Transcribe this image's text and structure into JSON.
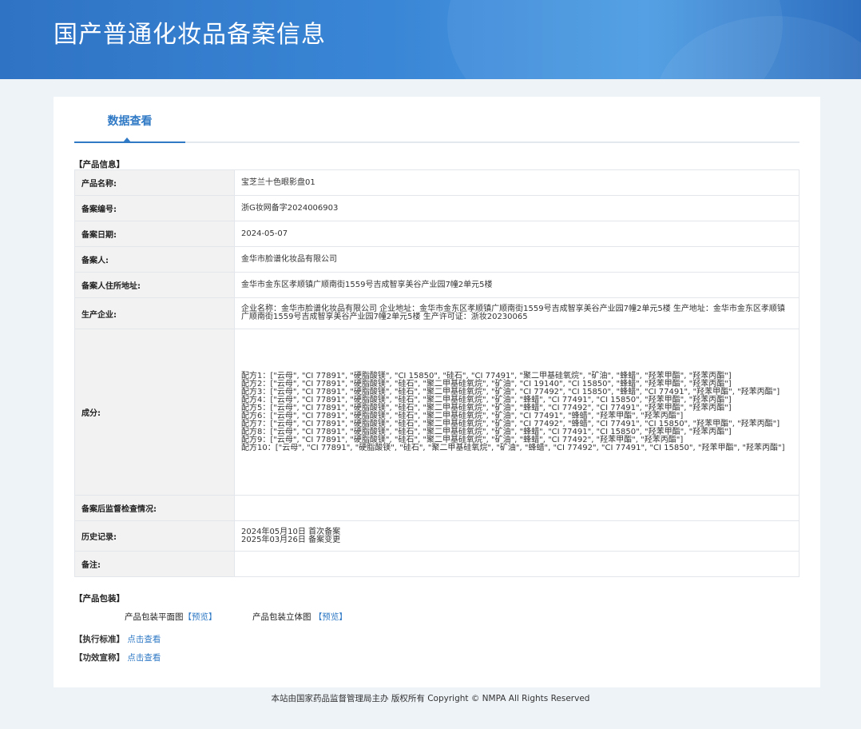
{
  "page": {
    "title": "国产普通化妆品备案信息"
  },
  "tab": {
    "label": "数据查看"
  },
  "sections": {
    "product_info": "【产品信息】",
    "packaging": "【产品包装】",
    "standard": "【执行标准】",
    "efficacy": "【功效宣称】"
  },
  "rows": [
    {
      "label": "产品名称:",
      "value": "宝芝兰十色眼影盘01"
    },
    {
      "label": "备案编号:",
      "value": "浙G妆网备字2024006903"
    },
    {
      "label": "备案日期:",
      "value": "2024-05-07"
    },
    {
      "label": "备案人:",
      "value": "金华市脸谱化妆品有限公司"
    },
    {
      "label": "备案人住所地址:",
      "value": "金华市金东区孝顺镇广顺南街1559号吉成智享美谷产业园7幢2单元5楼"
    },
    {
      "label": "生产企业:",
      "value": "企业名称：金华市脸谱化妆品有限公司 企业地址：金华市金东区孝顺镇广顺南街1559号吉成智享美谷产业园7幢2单元5楼 生产地址：金华市金东区孝顺镇广顺南街1559号吉成智享美谷产业园7幢2单元5楼 生产许可证：浙妆20230065"
    },
    {
      "label": "成分:",
      "value": [
        "配方1：[\"云母\", \"CI 77891\", \"硬脂酸镁\", \"CI 15850\", \"硅石\", \"CI 77491\", \"聚二甲基硅氧烷\", \"矿油\", \"蜂蜡\", \"羟苯甲酯\", \"羟苯丙酯\"]",
        "配方2：[\"云母\", \"CI 77891\", \"硬脂酸镁\", \"硅石\", \"聚二甲基硅氧烷\", \"矿油\", \"CI 19140\", \"CI 15850\", \"蜂蜡\", \"羟苯甲酯\", \"羟苯丙酯\"]",
        "配方3：[\"云母\", \"CI 77891\", \"硬脂酸镁\", \"硅石\", \"聚二甲基硅氧烷\", \"矿油\", \"CI 77492\", \"CI 15850\", \"蜂蜡\", \"CI 77491\", \"羟苯甲酯\", \"羟苯丙酯\"]",
        "配方4：[\"云母\", \"CI 77891\", \"硬脂酸镁\", \"硅石\", \"聚二甲基硅氧烷\", \"矿油\", \"蜂蜡\", \"CI 77491\", \"CI 15850\", \"羟苯甲酯\", \"羟苯丙酯\"]",
        "配方5：[\"云母\", \"CI 77891\", \"硬脂酸镁\", \"硅石\", \"聚二甲基硅氧烷\", \"矿油\", \"蜂蜡\", \"CI 77492\", \"CI 77491\", \"羟苯甲酯\", \"羟苯丙酯\"]",
        "配方6：[\"云母\", \"CI 77891\", \"硬脂酸镁\", \"硅石\", \"聚二甲基硅氧烷\", \"矿油\", \"CI 77491\", \"蜂蜡\", \"羟苯甲酯\", \"羟苯丙酯\"]",
        "配方7：[\"云母\", \"CI 77891\", \"硬脂酸镁\", \"硅石\", \"聚二甲基硅氧烷\", \"矿油\", \"CI 77492\", \"蜂蜡\", \"CI 77491\", \"CI 15850\", \"羟苯甲酯\", \"羟苯丙酯\"]",
        "配方8：[\"云母\", \"CI 77891\", \"硬脂酸镁\", \"硅石\", \"聚二甲基硅氧烷\", \"矿油\", \"蜂蜡\", \"CI 77491\", \"CI 15850\", \"羟苯甲酯\", \"羟苯丙酯\"]",
        "配方9：[\"云母\", \"CI 77891\", \"硬脂酸镁\", \"硅石\", \"聚二甲基硅氧烷\", \"矿油\", \"蜂蜡\", \"CI 77492\", \"羟苯甲酯\", \"羟苯丙酯\"]",
        "配方10：[\"云母\", \"CI 77891\", \"硬脂酸镁\", \"硅石\", \"聚二甲基硅氧烷\", \"矿油\", \"蜂蜡\", \"CI 77492\", \"CI 77491\", \"CI 15850\", \"羟苯甲酯\", \"羟苯丙酯\"]"
      ]
    },
    {
      "label": "备案后监督检查情况:",
      "value": ""
    },
    {
      "label": "历史记录:",
      "value": [
        "2024年05月10日 首次备案",
        "2025年03月26日 备案变更"
      ]
    },
    {
      "label": "备注:",
      "value": ""
    }
  ],
  "packaging": {
    "flat_label": "产品包装平面图",
    "flat_link": "【预览】",
    "solid_label": "产品包装立体图",
    "solid_link": "【预览】"
  },
  "standard_link": "点击查看",
  "efficacy_link": "点击查看",
  "footer": "本站由国家药品监督管理局主办 版权所有 Copyright © NMPA All Rights Reserved"
}
